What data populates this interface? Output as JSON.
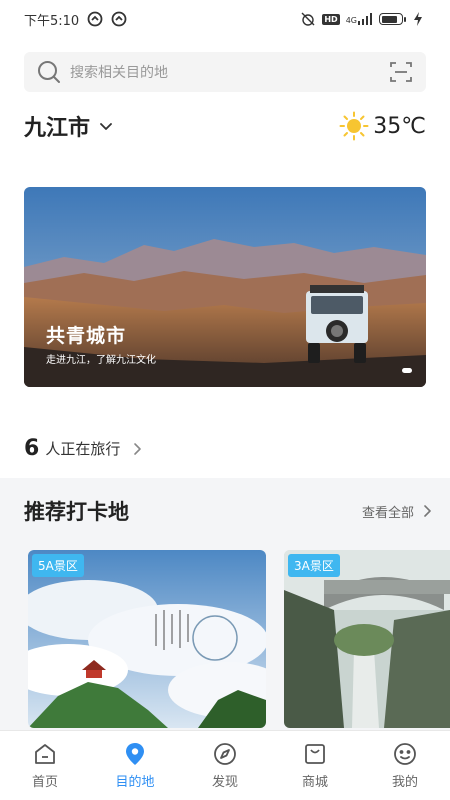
{
  "status_bar": {
    "time": "下午5:10",
    "network": "4G"
  },
  "search": {
    "placeholder": "搜索相关目的地"
  },
  "location": {
    "city": "九江市",
    "temperature": "35℃"
  },
  "banner": {
    "title": "共青城市",
    "subtitle": "走进九江，了解九江文化"
  },
  "travelers": {
    "count": "6",
    "label": "人正在旅行"
  },
  "recommend": {
    "title": "推荐打卡地",
    "see_all": "查看全部",
    "cards": [
      {
        "badge": "5A景区"
      },
      {
        "badge": "3A景区"
      }
    ]
  },
  "tabs": [
    {
      "label": "首页",
      "icon": "home-icon",
      "active": false
    },
    {
      "label": "目的地",
      "icon": "location-pin-icon",
      "active": true
    },
    {
      "label": "发现",
      "icon": "compass-icon",
      "active": false
    },
    {
      "label": "商城",
      "icon": "shop-icon",
      "active": false
    },
    {
      "label": "我的",
      "icon": "profile-icon",
      "active": false
    }
  ],
  "colors": {
    "accent": "#2f8ff3",
    "badge": "#3fb7f0",
    "sun": "#f7c531"
  }
}
